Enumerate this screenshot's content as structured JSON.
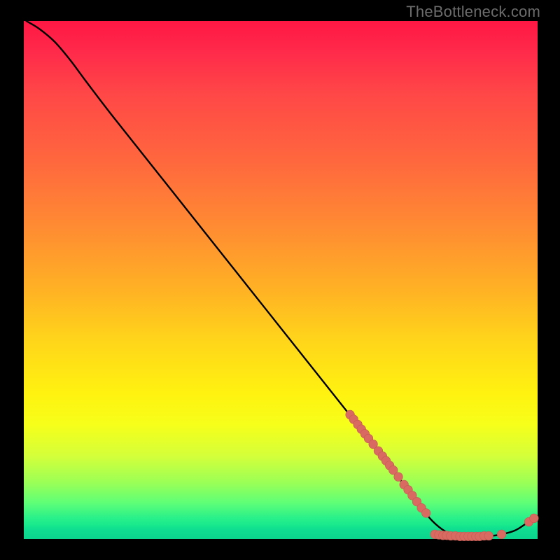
{
  "watermark": "TheBottleneck.com",
  "colors": {
    "line": "#000000",
    "dot": "#d86a62",
    "dot_stroke": "#c45a52"
  },
  "chart_data": {
    "type": "line",
    "title": "",
    "xlabel": "",
    "ylabel": "",
    "xlim": [
      0,
      100
    ],
    "ylim": [
      0,
      100
    ],
    "grid": false,
    "legend": false,
    "line_points": [
      {
        "x": 0.5,
        "y": 100.0
      },
      {
        "x": 3.0,
        "y": 98.5
      },
      {
        "x": 6.0,
        "y": 96.0
      },
      {
        "x": 9.0,
        "y": 92.5
      },
      {
        "x": 12.0,
        "y": 88.5
      },
      {
        "x": 17.0,
        "y": 82.0
      },
      {
        "x": 25.0,
        "y": 72.0
      },
      {
        "x": 35.0,
        "y": 59.5
      },
      {
        "x": 45.0,
        "y": 47.0
      },
      {
        "x": 55.0,
        "y": 34.5
      },
      {
        "x": 65.0,
        "y": 22.0
      },
      {
        "x": 70.0,
        "y": 15.5
      },
      {
        "x": 74.0,
        "y": 10.5
      },
      {
        "x": 77.0,
        "y": 6.5
      },
      {
        "x": 79.5,
        "y": 3.5
      },
      {
        "x": 82.0,
        "y": 1.5
      },
      {
        "x": 84.5,
        "y": 0.6
      },
      {
        "x": 88.0,
        "y": 0.5
      },
      {
        "x": 91.0,
        "y": 0.6
      },
      {
        "x": 93.0,
        "y": 0.9
      },
      {
        "x": 95.5,
        "y": 1.6
      },
      {
        "x": 97.5,
        "y": 2.8
      },
      {
        "x": 99.5,
        "y": 4.2
      }
    ],
    "scatter_points": [
      {
        "x": 63.5,
        "y": 24.0
      },
      {
        "x": 64.2,
        "y": 23.1
      },
      {
        "x": 65.0,
        "y": 22.1
      },
      {
        "x": 65.7,
        "y": 21.2
      },
      {
        "x": 66.4,
        "y": 20.3
      },
      {
        "x": 67.1,
        "y": 19.4
      },
      {
        "x": 68.0,
        "y": 18.3
      },
      {
        "x": 69.0,
        "y": 17.0
      },
      {
        "x": 69.8,
        "y": 16.0
      },
      {
        "x": 70.5,
        "y": 15.1
      },
      {
        "x": 71.2,
        "y": 14.2
      },
      {
        "x": 71.9,
        "y": 13.3
      },
      {
        "x": 72.9,
        "y": 12.0
      },
      {
        "x": 74.0,
        "y": 10.5
      },
      {
        "x": 74.8,
        "y": 9.5
      },
      {
        "x": 75.6,
        "y": 8.4
      },
      {
        "x": 76.5,
        "y": 7.2
      },
      {
        "x": 77.4,
        "y": 6.0
      },
      {
        "x": 78.3,
        "y": 5.0
      },
      {
        "x": 80.0,
        "y": 0.9
      },
      {
        "x": 80.8,
        "y": 0.8
      },
      {
        "x": 81.6,
        "y": 0.7
      },
      {
        "x": 82.3,
        "y": 0.7
      },
      {
        "x": 83.1,
        "y": 0.6
      },
      {
        "x": 84.0,
        "y": 0.6
      },
      {
        "x": 84.9,
        "y": 0.5
      },
      {
        "x": 85.7,
        "y": 0.5
      },
      {
        "x": 86.5,
        "y": 0.5
      },
      {
        "x": 87.2,
        "y": 0.5
      },
      {
        "x": 88.0,
        "y": 0.5
      },
      {
        "x": 88.7,
        "y": 0.5
      },
      {
        "x": 89.6,
        "y": 0.6
      },
      {
        "x": 90.5,
        "y": 0.6
      },
      {
        "x": 93.0,
        "y": 0.9
      },
      {
        "x": 98.3,
        "y": 3.3
      },
      {
        "x": 99.3,
        "y": 4.0
      }
    ]
  }
}
